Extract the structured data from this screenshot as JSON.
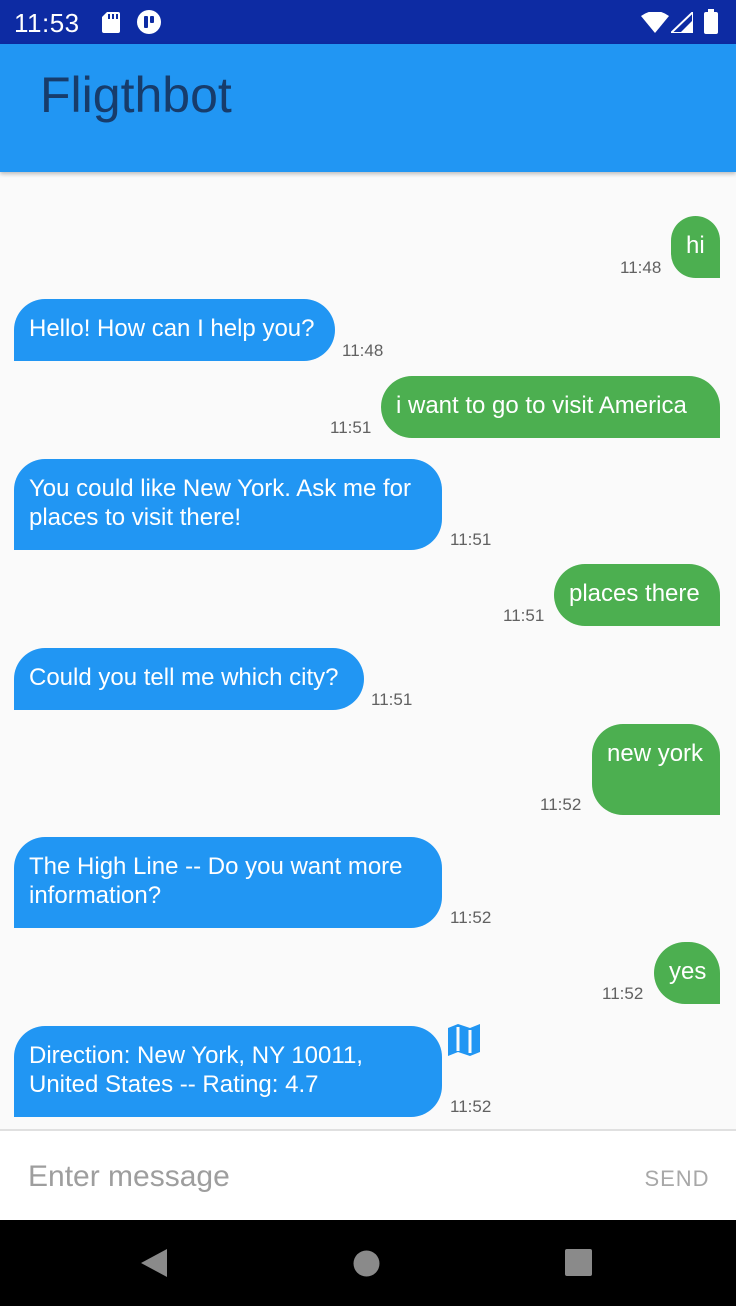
{
  "status_bar": {
    "time": "11:53",
    "icons": [
      "sd-card-icon",
      "app-notification-icon",
      "wifi-icon",
      "signal-icon",
      "battery-icon"
    ]
  },
  "app": {
    "title": "Fligthbot",
    "bar_color": "#2196f3",
    "title_color": "#173c6b"
  },
  "colors": {
    "bot_bubble": "#2196f3",
    "user_bubble": "#4caf50",
    "status_bar": "#0d2ba3"
  },
  "chat": {
    "messages": [
      {
        "sender": "user",
        "text": "hi",
        "time": "11:48"
      },
      {
        "sender": "bot",
        "text": "Hello! How can I help you?",
        "time": "11:48"
      },
      {
        "sender": "user",
        "text": "i want to go to visit America",
        "time": "11:51"
      },
      {
        "sender": "bot",
        "text": "You could like New York. Ask me for places to visit there!",
        "time": "11:51"
      },
      {
        "sender": "user",
        "text": "places there",
        "time": "11:51"
      },
      {
        "sender": "bot",
        "text": "Could you tell me which city?",
        "time": "11:51"
      },
      {
        "sender": "user",
        "text": "new york",
        "time": "11:52"
      },
      {
        "sender": "bot",
        "text": "The High Line -- Do you want more information?",
        "time": "11:52"
      },
      {
        "sender": "user",
        "text": "yes",
        "time": "11:52"
      },
      {
        "sender": "bot",
        "text": "Direction: New York, NY 10011, United States -- Rating: 4.7",
        "time": "11:52",
        "icon": "map-icon"
      }
    ]
  },
  "input": {
    "placeholder": "Enter message",
    "value": "",
    "send_label": "SEND"
  },
  "nav_bar": {
    "icons": [
      "back-icon",
      "home-icon",
      "recents-icon"
    ]
  }
}
